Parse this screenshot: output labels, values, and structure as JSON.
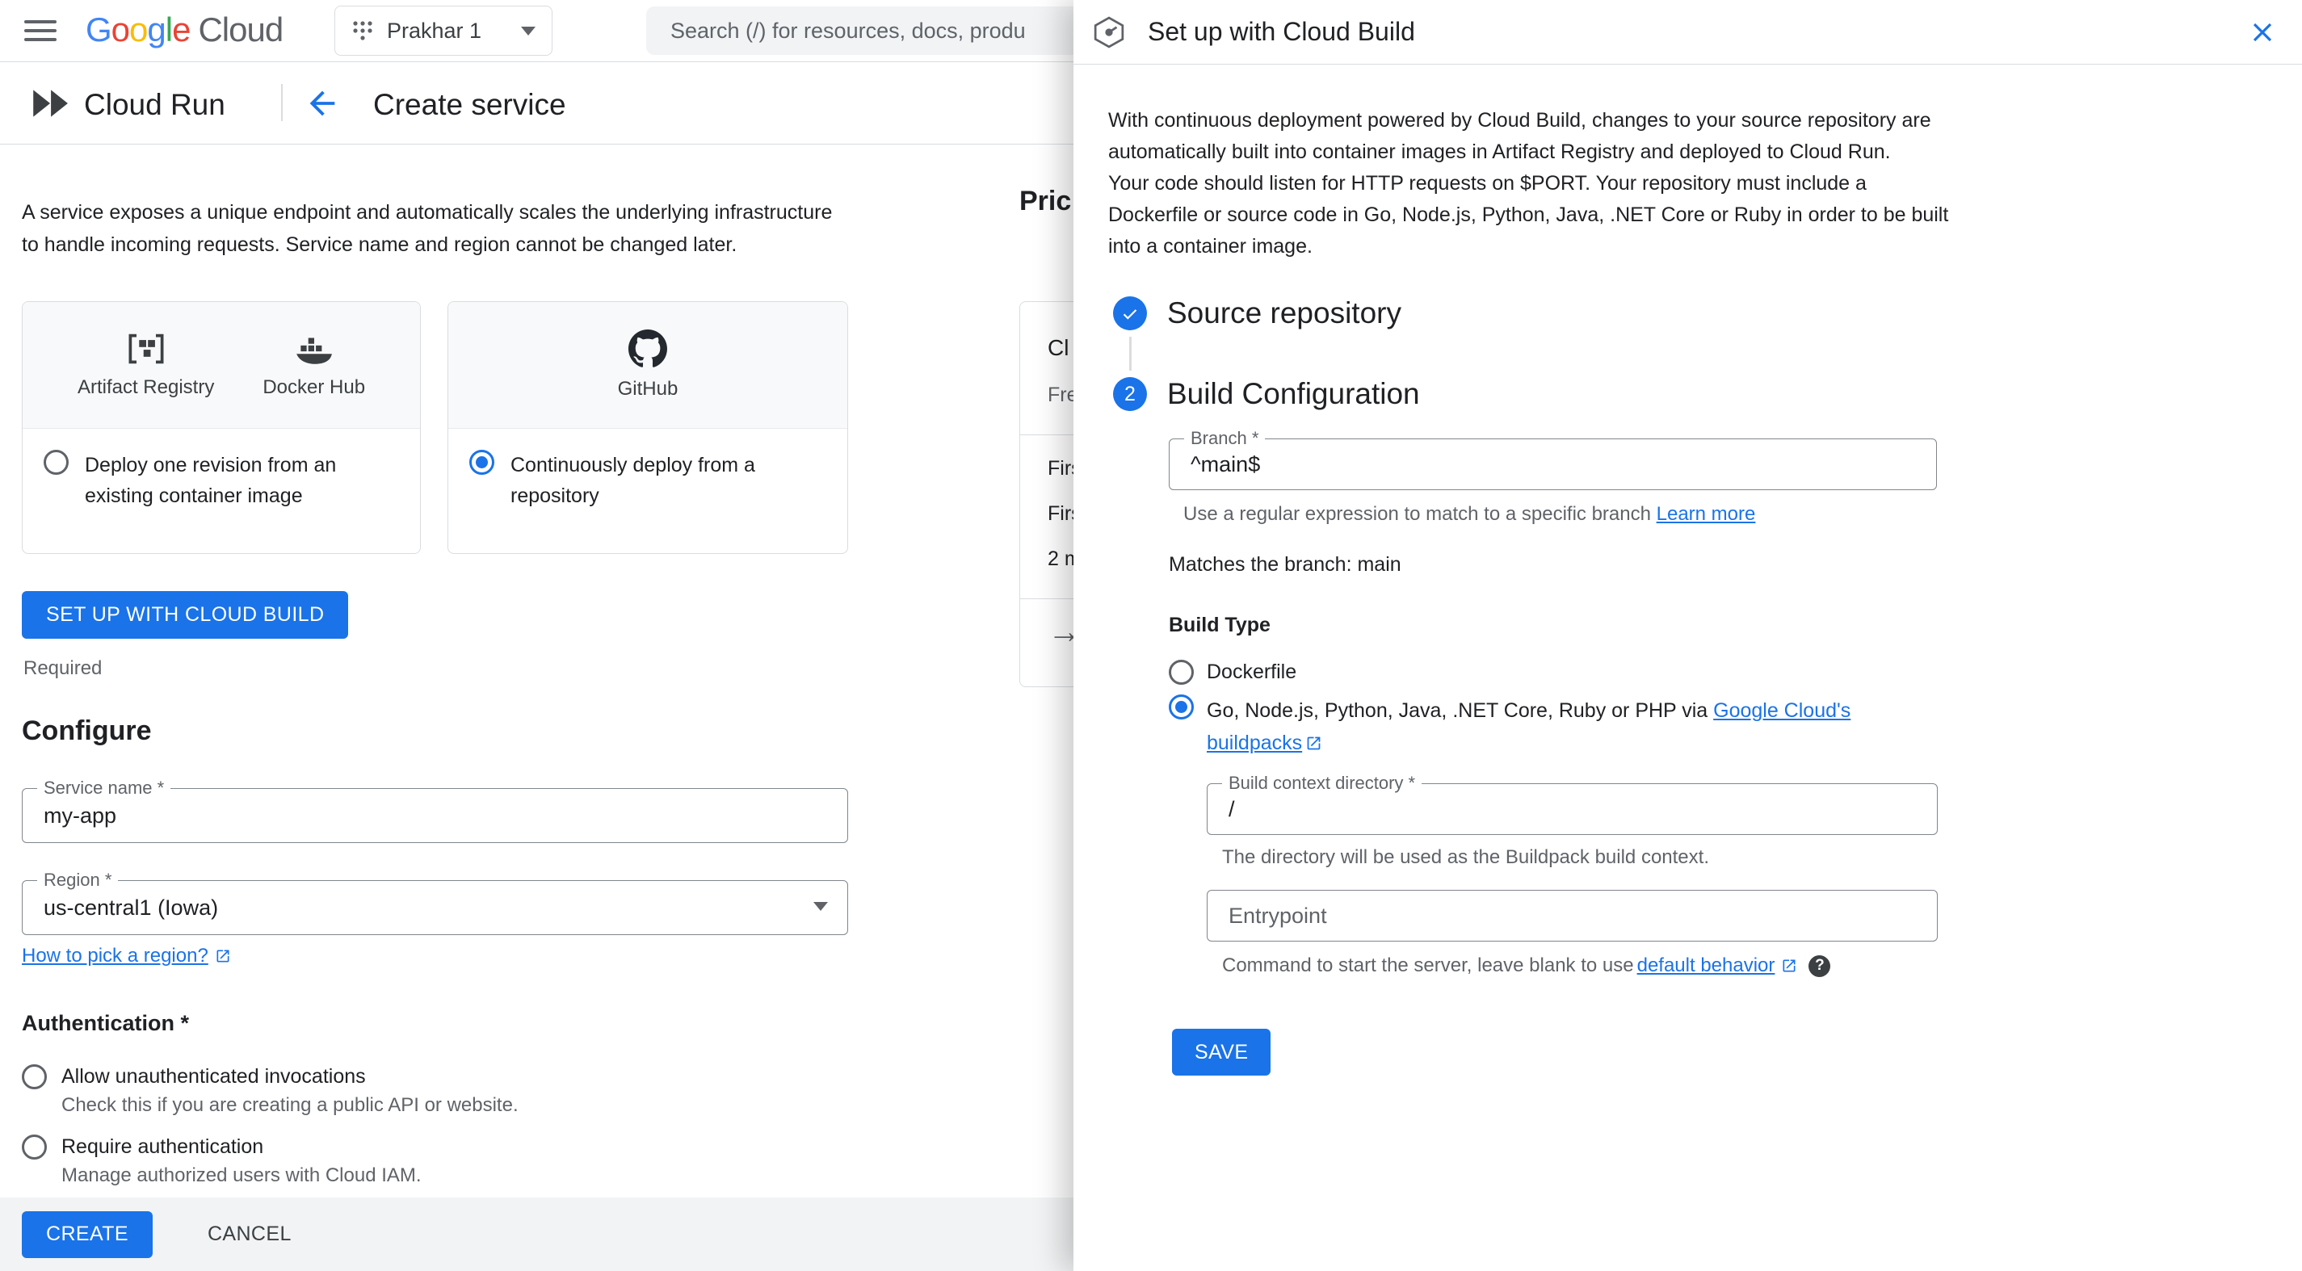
{
  "colors": {
    "accent": "#1a73e8",
    "text": "#202124",
    "muted": "#5f6368",
    "border": "#dadce0"
  },
  "topbar": {
    "logo_letters": [
      {
        "ch": "G",
        "color": "#4285F4"
      },
      {
        "ch": "o",
        "color": "#EA4335"
      },
      {
        "ch": "o",
        "color": "#FBBC05"
      },
      {
        "ch": "g",
        "color": "#4285F4"
      },
      {
        "ch": "l",
        "color": "#34A853"
      },
      {
        "ch": "e",
        "color": "#EA4335"
      }
    ],
    "logo_suffix": "Cloud",
    "project_name": "Prakhar 1",
    "search_placeholder": "Search (/) for resources, docs, produ"
  },
  "subheader": {
    "product": "Cloud Run",
    "title": "Create service"
  },
  "main": {
    "intro": "A service exposes a unique endpoint and automatically scales the underlying infrastructure to handle incoming requests. Service name and region cannot be changed later.",
    "card_container": {
      "icon1_label": "Artifact Registry",
      "icon2_label": "Docker Hub",
      "option": "Deploy one revision from an existing container image",
      "selected": false
    },
    "card_repo": {
      "icon1_label": "GitHub",
      "option": "Continuously deploy from a repository",
      "selected": true
    },
    "setup_button": "SET UP WITH CLOUD BUILD",
    "required": "Required",
    "configure": "Configure",
    "service_name": {
      "label": "Service name *",
      "value": "my-app"
    },
    "region": {
      "label": "Region *",
      "value": "us-central1 (Iowa)"
    },
    "region_link": "How to pick a region?",
    "auth_heading": "Authentication *",
    "auth1": {
      "label": "Allow unauthenticated invocations",
      "desc": "Check this if you are creating a public API or website.",
      "selected": false
    },
    "auth2": {
      "label": "Require authentication",
      "desc": "Manage authorized users with Cloud IAM.",
      "selected": false
    },
    "create": "CREATE",
    "cancel": "CANCEL"
  },
  "pricing": {
    "heading": "Pric",
    "title": "Cl",
    "subtitle": "Fre",
    "row1": "Firs",
    "row2": "Firs",
    "row3": "2 m"
  },
  "panel": {
    "title": "Set up with Cloud Build",
    "intro1": "With continuous deployment powered by Cloud Build, changes to your source repository are automatically built into container images in Artifact Registry and deployed to Cloud Run.",
    "intro2": "Your code should listen for HTTP requests on $PORT. Your repository must include a Dockerfile or source code in Go, Node.js, Python, Java, .NET Core or Ruby in order to be built into a container image.",
    "step1_title": "Source repository",
    "step2_number": "2",
    "step2_title": "Build Configuration",
    "branch": {
      "label": "Branch *",
      "value": "^main$"
    },
    "branch_helper": "Use a regular expression to match to a specific branch ",
    "branch_helper_link": "Learn more",
    "match_note": "Matches the branch: main",
    "build_type": "Build Type",
    "opt_dockerfile": {
      "label": "Dockerfile",
      "selected": false
    },
    "opt_buildpacks": {
      "prefix": "Go, Node.js, Python, Java, .NET Core, Ruby or PHP via ",
      "link": "Google Cloud's buildpacks",
      "selected": true
    },
    "context": {
      "label": "Build context directory *",
      "value": "/",
      "helper": "The directory will be used as the Buildpack build context."
    },
    "entrypoint": {
      "placeholder": "Entrypoint",
      "helper_prefix": "Command to start the server, leave blank to use ",
      "helper_link": "default behavior"
    },
    "save": "SAVE"
  }
}
